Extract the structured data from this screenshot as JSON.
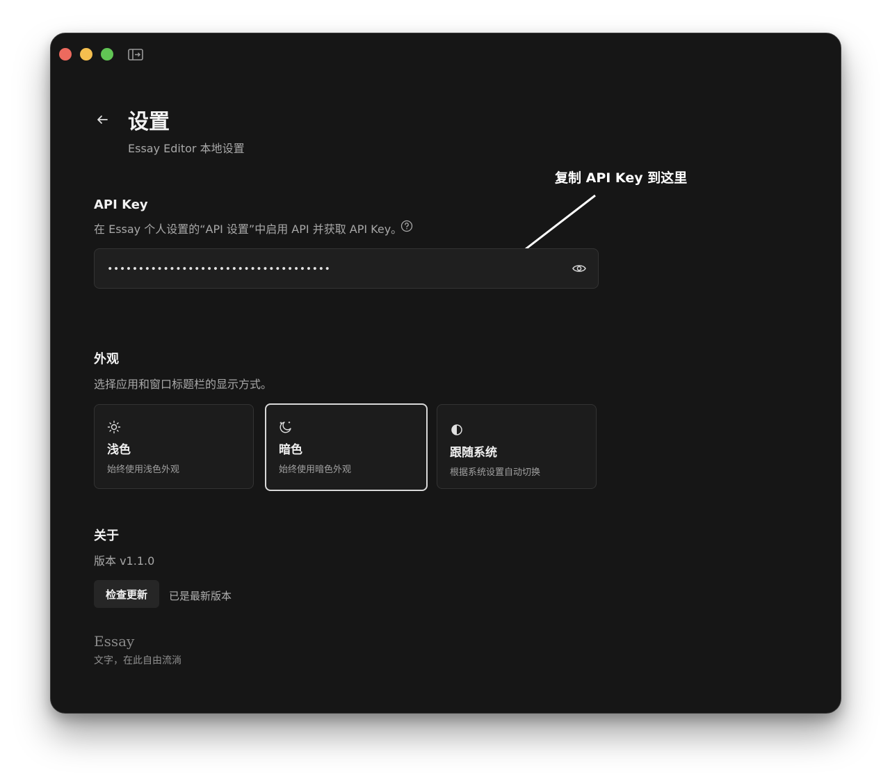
{
  "header": {
    "title": "设置",
    "subtitle": "Essay Editor 本地设置"
  },
  "annotation": {
    "text": "复制 API Key 到这里"
  },
  "api_key": {
    "title": "API Key",
    "description": "在 Essay 个人设置的“API 设置”中启用 API 并获取 API Key。",
    "value": "••••••••••••••••••••••••••••••••••••"
  },
  "appearance": {
    "title": "外观",
    "description": "选择应用和窗口标题栏的显示方式。",
    "options": [
      {
        "title": "浅色",
        "desc": "始终使用浅色外观",
        "icon": "sun-icon",
        "selected": false
      },
      {
        "title": "暗色",
        "desc": "始终使用暗色外观",
        "icon": "moon-icon",
        "selected": true
      },
      {
        "title": "跟随系统",
        "desc": "根据系统设置自动切换",
        "icon": "half-circle-icon",
        "selected": false
      }
    ]
  },
  "about": {
    "title": "关于",
    "version": "版本 v1.1.0",
    "check_label": "检查更新",
    "status": "已是最新版本"
  },
  "footer": {
    "brand": "Essay",
    "tagline": "文字，在此自由流淌"
  }
}
